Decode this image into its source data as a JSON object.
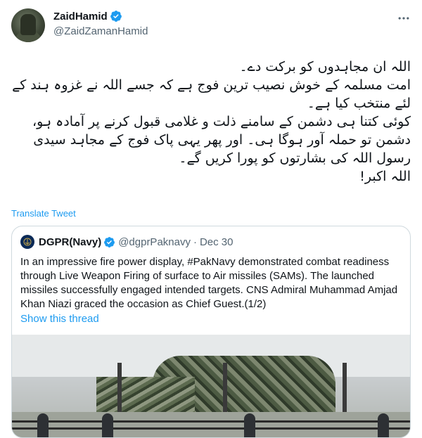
{
  "author": {
    "name": "ZaidHamid",
    "handle": "@ZaidZamanHamid"
  },
  "body": {
    "lines": [
      "اللہ ان مجاہدوں کو برکت دے۔",
      "امت مسلمہ کے خوش نصیب ترین فوج ہے کہ  جسے اللہ نے غزوہ ہند کے لئے منتخب کیا ہے۔",
      "کوئی کتنا ہی دشمن کے سامنے ذلت و غلامی قبول کرنے پر آمادہ ہو، دشمن تو حملہ آور ہوگا ہی۔ اور پھر یہی پاک فوج کے مجاہد سیدی رسول اللہ کی بشارتوں کو پورا کریں گے۔",
      "اللہ اکبر!"
    ]
  },
  "translate_label": "Translate Tweet",
  "quoted": {
    "name": "DGPR(Navy)",
    "handle": "@dgprPaknavy",
    "separator": "·",
    "date": "Dec 30",
    "text": "In an impressive fire power display, #PakNavy demonstrated combat readiness through Live Weapon Firing of surface to Air missiles (SAMs). The launched missiles successfully engaged intended targets. CNS Admiral Muhammad Amjad Khan Niazi graced the occasion as Chief Guest.(1/2)",
    "show_thread": "Show this thread"
  },
  "icons": {
    "verified": "verified-badge-icon",
    "more": "more-options-icon"
  },
  "colors": {
    "accent": "#1d9bf0",
    "text": "#0f1419",
    "secondary": "#536471",
    "border": "#cfd9de"
  }
}
